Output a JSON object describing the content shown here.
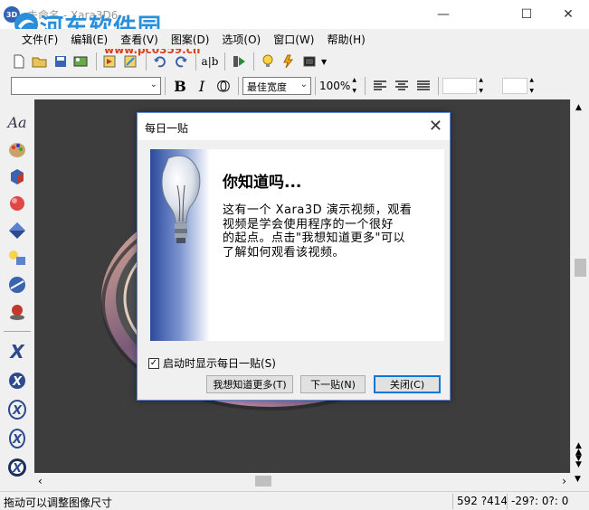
{
  "window": {
    "title": "未命名 - Xara3D6",
    "app_icon": "3D"
  },
  "watermark": {
    "text": "河东软件园",
    "url": "www.pc0359.cn"
  },
  "menu": [
    {
      "label": "文件(F)"
    },
    {
      "label": "编辑(E)"
    },
    {
      "label": "查看(V)"
    },
    {
      "label": "图案(D)"
    },
    {
      "label": "选项(O)"
    },
    {
      "label": "窗口(W)"
    },
    {
      "label": "帮助(H)"
    }
  ],
  "toolbar2": {
    "font_value": "",
    "width_mode": "最佳宽度",
    "zoom": "100%",
    "bold": "B",
    "italic": "I",
    "outline": "O"
  },
  "statusbar": {
    "hint": "拖动可以调整图像尺寸",
    "size": "592 ?414",
    "angles": "-29?: 0?: 0"
  },
  "dialog": {
    "title": "每日一贴",
    "heading": "你知道吗...",
    "body_lines": [
      "这有一个 Xara3D 演示视频，观看",
      "视频是学会使用程序的一个很好",
      "的起点。点击\"我想知道更多\"可以",
      "了解如何观看该视频。"
    ],
    "checkbox_label": "启动时显示每日一贴(S)",
    "checkbox_checked": true,
    "buttons": {
      "more": "我想知道更多(T)",
      "next": "下一贴(N)",
      "close": "关闭(C)"
    }
  },
  "colors": {
    "canvas_bg": "#3d3d3d",
    "accent": "#0078d7",
    "watermark": "#2a8fd8"
  }
}
